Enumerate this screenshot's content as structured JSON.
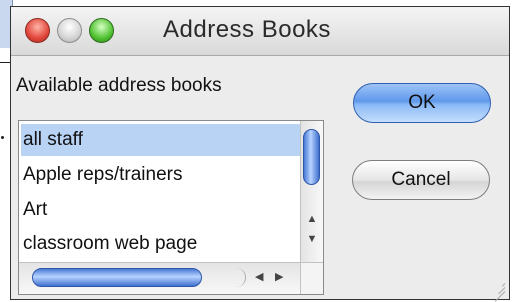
{
  "window": {
    "title": "Address Books"
  },
  "label": "Available address books",
  "list": {
    "items": [
      {
        "label": "all staff",
        "selected": true
      },
      {
        "label": "Apple reps/trainers",
        "selected": false
      },
      {
        "label": "Art",
        "selected": false
      },
      {
        "label": "classroom web page",
        "selected": false
      }
    ]
  },
  "buttons": {
    "ok": "OK",
    "cancel": "Cancel"
  },
  "icons": {
    "close": "close-button-icon",
    "minimize": "minimize-button-icon",
    "zoom": "zoom-button-icon",
    "scroll_up": "▲",
    "scroll_down": "▼",
    "scroll_left": "◀",
    "scroll_right": "▶"
  },
  "colors": {
    "selection": "#b9d3f4",
    "accent": "#5f98ea"
  }
}
